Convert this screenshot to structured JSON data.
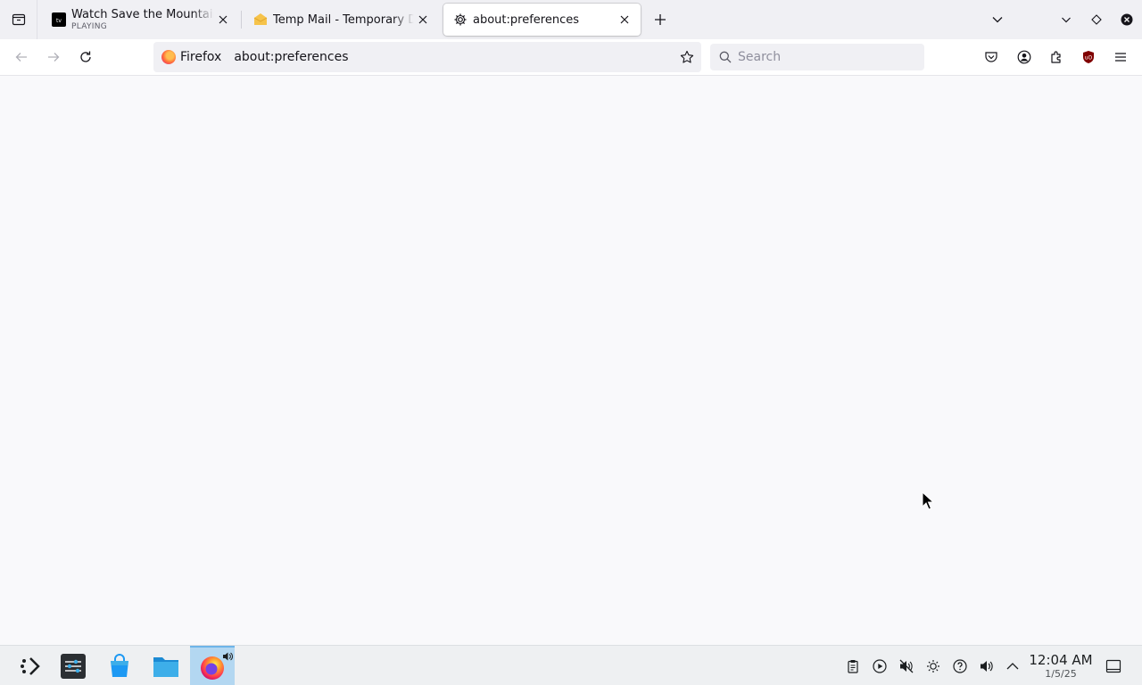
{
  "tabs": [
    {
      "title": "Watch Save the Mountain",
      "subtitle": "PLAYING",
      "favicon": "appletv-icon",
      "selected": false
    },
    {
      "title": "Temp Mail - Temporary Disposable Email",
      "favicon": "tempmail-icon",
      "selected": false
    },
    {
      "title": "about:preferences",
      "favicon": "gear-icon",
      "selected": true
    }
  ],
  "navbar": {
    "identity_label": "Firefox",
    "url": "about:preferences",
    "search_placeholder": "Search"
  },
  "taskbar": {
    "time": "12:04 AM",
    "date": "1/5/25"
  },
  "colors": {
    "tab_strip": "#f0f0f4",
    "content_bg": "#f9f9fb",
    "taskbar_bg": "#eef0f2",
    "active_task": "#b3d7f1",
    "ublock_red": "#800000"
  }
}
